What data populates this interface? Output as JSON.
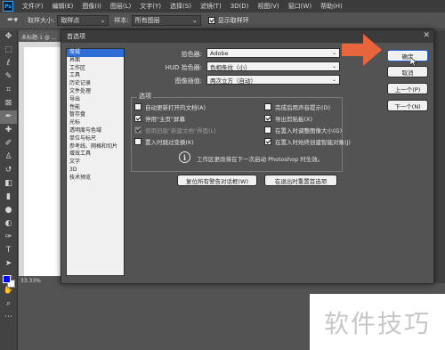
{
  "menubar": {
    "logo": "Ps",
    "items": [
      "文件(F)",
      "编辑(E)",
      "图像(I)",
      "图层(L)",
      "文字(Y)",
      "选择(S)",
      "滤镜(T)",
      "3D(D)",
      "视图(V)",
      "窗口(W)",
      "帮助(H)"
    ]
  },
  "options_bar": {
    "sample_size_label": "取样大小:",
    "sample_size_value": "取样点",
    "sample_label": "样本:",
    "sample_value": "所有图层",
    "show_ring_label": "显示取样环",
    "show_ring_checked": true
  },
  "toolbox": {
    "tools": [
      "move-icon",
      "marquee-icon",
      "lasso-icon",
      "quick-select-icon",
      "crop-icon",
      "frame-icon",
      "eyedropper-icon",
      "healing-icon",
      "brush-icon",
      "stamp-icon",
      "history-brush-icon",
      "eraser-icon",
      "gradient-icon",
      "blur-icon",
      "dodge-icon",
      "pen-icon",
      "type-icon",
      "path-select-icon",
      "shape-icon",
      "hand-icon",
      "zoom-icon",
      "more-icon"
    ],
    "active_tool": "eyedropper-icon",
    "foreground_color": "#0000ff",
    "background_color": "#ffffff"
  },
  "document": {
    "tab_title": "未标题-1 @ ...",
    "zoom": "33.33%"
  },
  "dialog": {
    "title": "首选项",
    "close": "✕",
    "nav": [
      {
        "label": "常规",
        "selected": true
      },
      {
        "label": "界面",
        "selected": false
      },
      {
        "label": "工作区",
        "selected": false
      },
      {
        "label": "工具",
        "selected": false
      },
      {
        "label": "历史记录",
        "selected": false
      },
      {
        "label": "文件处理",
        "selected": false
      },
      {
        "label": "导出",
        "selected": false
      },
      {
        "label": "性能",
        "selected": false
      },
      {
        "label": "暂存盘",
        "selected": false
      },
      {
        "label": "光标",
        "selected": false
      },
      {
        "label": "透明度与色域",
        "selected": false
      },
      {
        "label": "单位与标尺",
        "selected": false
      },
      {
        "label": "参考线、网格和切片",
        "selected": false
      },
      {
        "label": "增效工具",
        "selected": false
      },
      {
        "label": "文字",
        "selected": false
      },
      {
        "label": "3D",
        "selected": false
      },
      {
        "label": "技术预览",
        "selected": false
      }
    ],
    "color_picker_label": "拾色器:",
    "color_picker_value": "Adobe",
    "hud_picker_label": "HUD 拾色器:",
    "hud_picker_value": "色相条纹（小）",
    "interpolation_label": "图像插值:",
    "interpolation_value": "两次立方（自动）",
    "options_group_title": "选项",
    "options_left": [
      {
        "label": "自动更新打开的文档(A)",
        "checked": false,
        "disabled": false
      },
      {
        "label": "停用\"主页\"屏幕",
        "checked": true,
        "disabled": false
      },
      {
        "label": "使用旧版\"新建文档\"界面(L)",
        "checked": true,
        "disabled": true
      },
      {
        "label": "置入时跳过变换(K)",
        "checked": false,
        "disabled": false
      }
    ],
    "options_right": [
      {
        "label": "完成后用声音提示(D)",
        "checked": false,
        "disabled": false
      },
      {
        "label": "导出剪贴板(X)",
        "checked": true,
        "disabled": false
      },
      {
        "label": "在置入时调整图像大小(G)",
        "checked": false,
        "disabled": false
      },
      {
        "label": "在置入时始终创建智能对象(J)",
        "checked": true,
        "disabled": false
      }
    ],
    "info_text": "工作区更改将在下一次启动 Photoshop 时生效。",
    "reset_warnings_button": "复位所有警告对话框(W)",
    "reset_prefs_button": "在退出时重置首选项",
    "ok_button": "确定",
    "cancel_button": "取消",
    "prev_button": "上一个(P)",
    "next_button": "下一个(N)"
  },
  "annotation": {
    "arrow_color": "#e8643c"
  },
  "watermark": {
    "text": "软件技巧"
  }
}
